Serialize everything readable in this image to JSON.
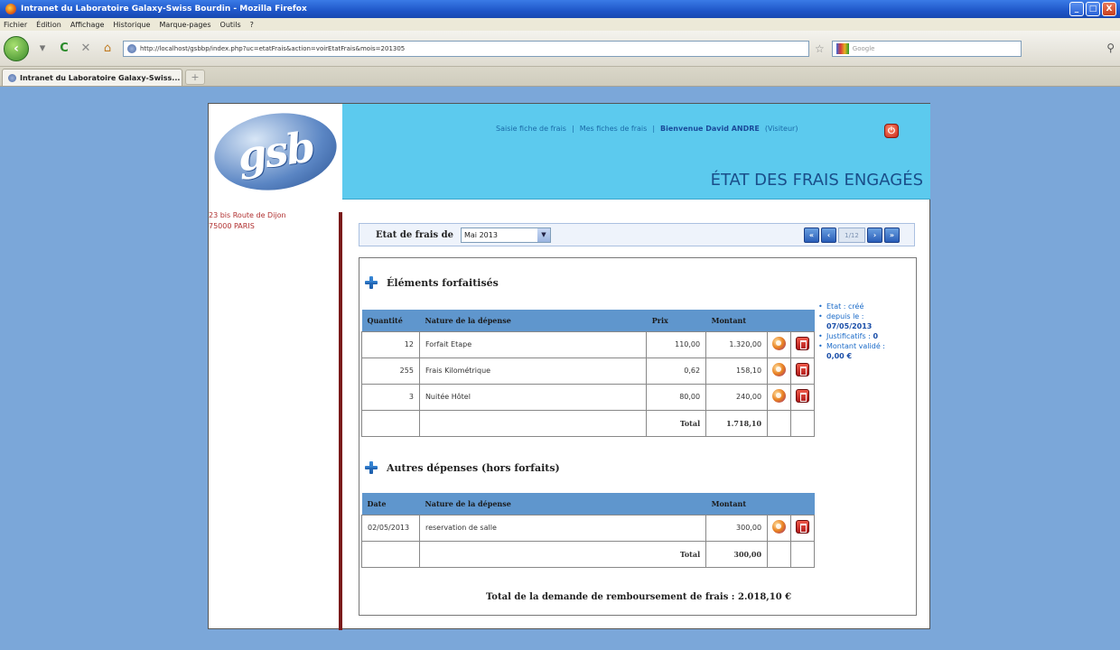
{
  "browser": {
    "window_title": "Intranet du Laboratoire Galaxy-Swiss Bourdin - Mozilla Firefox",
    "menu": [
      "Fichier",
      "Édition",
      "Affichage",
      "Historique",
      "Marque-pages",
      "Outils",
      "?"
    ],
    "url": "http://localhost/gsbbp/index.php?uc=etatFrais&action=voirEtatFrais&mois=201305",
    "search_placeholder": "Google",
    "tab_title": "Intranet du Laboratoire Galaxy-Swiss...",
    "window_buttons": [
      "_",
      "□",
      "X"
    ]
  },
  "site": {
    "logo_text": "gsb",
    "address_line1": "23 bis Route de Dijon",
    "address_line2": "75000 PARIS",
    "nav": {
      "saisie": "Saisie fiche de frais",
      "sep1": "|",
      "mes_fiches": "Mes fiches de frais",
      "welcome_prefix": "|",
      "welcome": "Bienvenue David ANDRE",
      "role": "(Visiteur)"
    },
    "page_title": "ÉTAT DES FRAIS ENGAGÉS",
    "colors": {
      "header": "#5ccaee",
      "table_header": "#5f96cd",
      "accent": "#1a4e8a"
    }
  },
  "selector": {
    "label": "Etat de frais de",
    "selected_month": "Mai 2013",
    "page_indicator": "1/12"
  },
  "forfait": {
    "title": "Éléments forfaitisés",
    "headers": {
      "qty": "Quantité",
      "nature": "Nature de la dépense",
      "prix": "Prix",
      "montant": "Montant"
    },
    "rows": [
      {
        "qty": "12",
        "nature": "Forfait Etape",
        "prix": "110,00",
        "montant": "1.320,00"
      },
      {
        "qty": "255",
        "nature": "Frais Kilométrique",
        "prix": "0,62",
        "montant": "158,10"
      },
      {
        "qty": "3",
        "nature": "Nuitée Hôtel",
        "prix": "80,00",
        "montant": "240,00"
      }
    ],
    "total_label": "Total",
    "total_value": "1.718,10"
  },
  "status": {
    "etat": "Etat : créé",
    "depuis_label": "depuis le :",
    "depuis_value": "07/05/2013",
    "justificatifs": "Justificatifs :",
    "justificatifs_value": "0",
    "montant_label": "Montant validé :",
    "montant_value": "0,00 €"
  },
  "hors_forfait": {
    "title": "Autres dépenses (hors forfaits)",
    "headers": {
      "date": "Date",
      "nature": "Nature de la dépense",
      "montant": "Montant"
    },
    "rows": [
      {
        "date": "02/05/2013",
        "nature": "reservation de salle",
        "montant": "300,00"
      }
    ],
    "total_label": "Total",
    "total_value": "300,00"
  },
  "grand_total": "Total de la demande de remboursement de frais : 2.018,10 €"
}
